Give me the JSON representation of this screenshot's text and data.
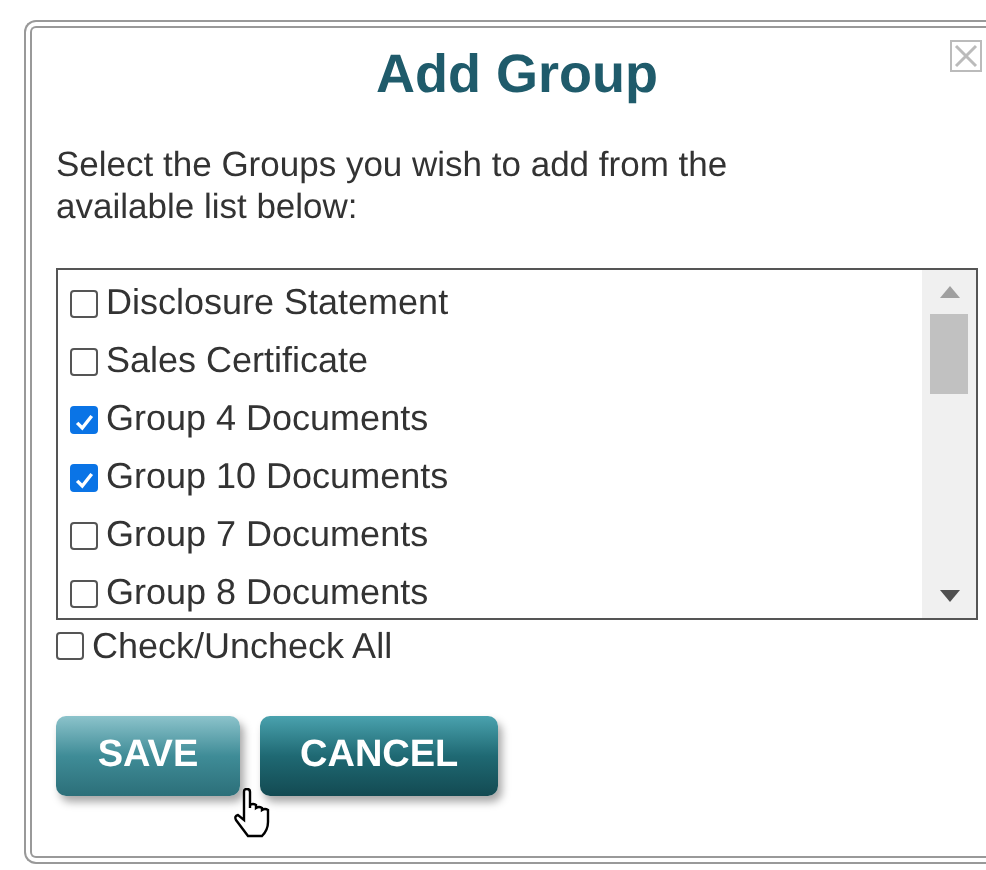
{
  "dialog": {
    "title": "Add Group",
    "instructions": "Select the Groups you wish to add from the available list below:"
  },
  "groups": [
    {
      "label": "Disclosure Statement",
      "checked": false
    },
    {
      "label": "Sales Certificate",
      "checked": false
    },
    {
      "label": "Group 4 Documents",
      "checked": true
    },
    {
      "label": "Group 10 Documents",
      "checked": true
    },
    {
      "label": "Group 7 Documents",
      "checked": false
    },
    {
      "label": "Group 8 Documents",
      "checked": false
    }
  ],
  "check_all": {
    "label": "Check/Uncheck All",
    "checked": false
  },
  "buttons": [
    {
      "label": "SAVE",
      "kind": "save"
    },
    {
      "label": "CANCEL",
      "kind": "cancel"
    }
  ]
}
